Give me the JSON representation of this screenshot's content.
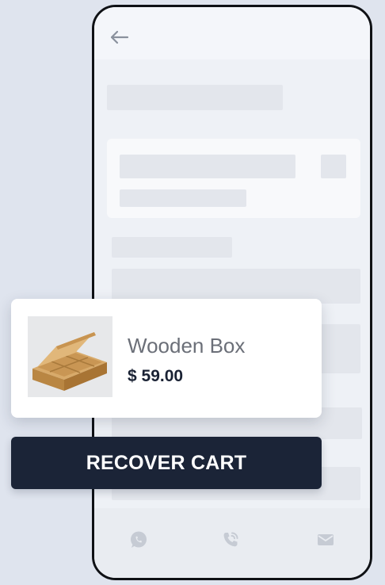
{
  "product": {
    "name": "Wooden Box",
    "price": "$ 59.00",
    "image": "wooden-box-image"
  },
  "actions": {
    "recover_label": "RECOVER CART"
  },
  "phone": {
    "back_icon": "arrow-left-icon",
    "bottom_icons": [
      "whatsapp-icon",
      "phone-call-icon",
      "mail-icon"
    ]
  },
  "colors": {
    "button_bg": "#1b2437",
    "page_bg": "#dfe4ee",
    "placeholder": "#e3e6ec"
  }
}
